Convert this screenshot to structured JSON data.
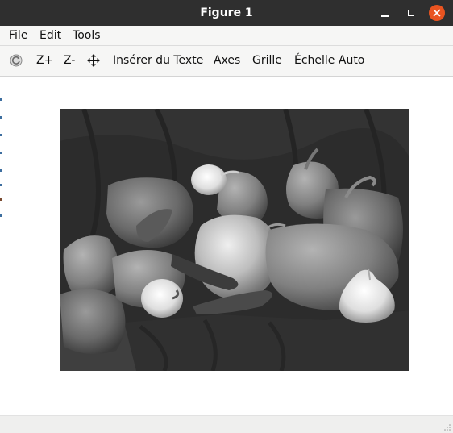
{
  "window": {
    "title": "Figure 1"
  },
  "menu": {
    "file": {
      "u": "F",
      "rest": "ile"
    },
    "edit": {
      "u": "E",
      "rest": "dit"
    },
    "tools": {
      "u": "T",
      "rest": "ools"
    }
  },
  "toolbar": {
    "home_icon": "reset-view-icon",
    "zoom_in_label": "Z+",
    "zoom_out_label": "Z-",
    "pan_icon": "move-arrows-icon",
    "insert_text_label": "Insérer du Texte",
    "axes_label": "Axes",
    "grid_label": "Grille",
    "autoscale_label": "Échelle Auto"
  },
  "colors": {
    "titlebar": "#2f2f2f",
    "close_button": "#e95420",
    "toolbar_bg": "#f6f6f5"
  }
}
